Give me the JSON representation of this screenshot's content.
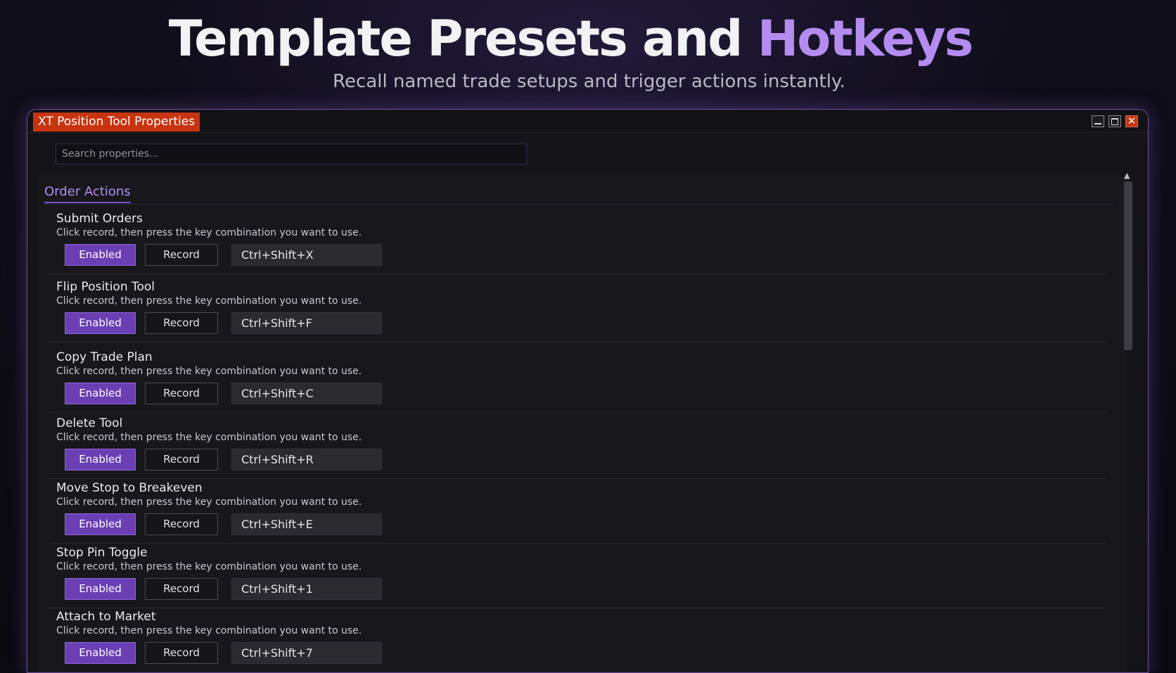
{
  "hero": {
    "title_main": "Template Presets and ",
    "title_accent": "Hotkeys",
    "subtitle": "Recall named trade setups and trigger actions instantly."
  },
  "window": {
    "title": "XT Position Tool Properties",
    "controls": {
      "close_glyph": "✕"
    }
  },
  "search": {
    "placeholder": "Search properties...",
    "value": ""
  },
  "section": {
    "title": "Order Actions"
  },
  "rows": [
    {
      "name": "Submit Orders",
      "description": "Click record, then press the key combination you want to use.",
      "enabled_label": "Enabled",
      "record_label": "Record",
      "hotkey": "Ctrl+Shift+X"
    },
    {
      "name": "Flip Position Tool",
      "description": "Click record, then press the key combination you want to use.",
      "enabled_label": "Enabled",
      "record_label": "Record",
      "hotkey": "Ctrl+Shift+F"
    },
    {
      "name": "Copy Trade Plan",
      "description": "Click record, then press the key combination you want to use.",
      "enabled_label": "Enabled",
      "record_label": "Record",
      "hotkey": "Ctrl+Shift+C"
    },
    {
      "name": "Delete Tool",
      "description": "Click record, then press the key combination you want to use.",
      "enabled_label": "Enabled",
      "record_label": "Record",
      "hotkey": "Ctrl+Shift+R"
    },
    {
      "name": "Move Stop to Breakeven",
      "description": "Click record, then press the key combination you want to use.",
      "enabled_label": "Enabled",
      "record_label": "Record",
      "hotkey": "Ctrl+Shift+E"
    },
    {
      "name": "Stop Pin Toggle",
      "description": "Click record, then press the key combination you want to use.",
      "enabled_label": "Enabled",
      "record_label": "Record",
      "hotkey": "Ctrl+Shift+1"
    },
    {
      "name": "Attach to Market",
      "description": "Click record, then press the key combination you want to use.",
      "enabled_label": "Enabled",
      "record_label": "Record",
      "hotkey": "Ctrl+Shift+7"
    }
  ],
  "colors": {
    "accent_purple": "#b48cf0",
    "enabled_button": "#6a3fb4",
    "title_tab": "#c8340f"
  }
}
